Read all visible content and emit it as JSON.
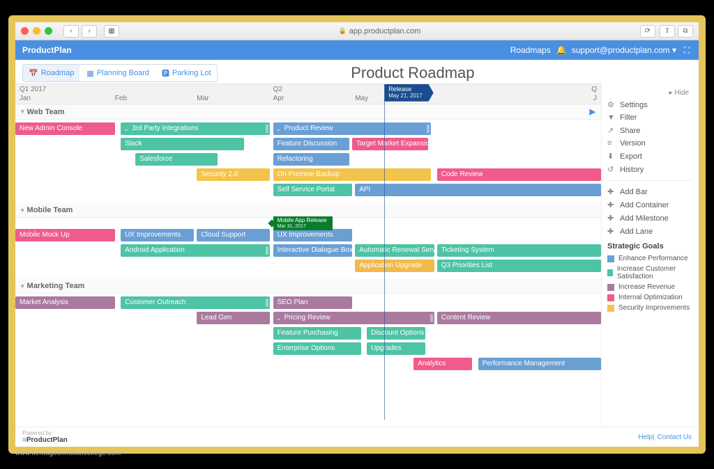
{
  "browser": {
    "url": "app.productplan.com"
  },
  "header": {
    "brand": "ProductPlan",
    "roadmaps": "Roadmaps",
    "user": "support@productplan.com ▾"
  },
  "viewtabs": {
    "roadmap": "Roadmap",
    "planning": "Planning Board",
    "parking": "Parking Lot"
  },
  "title": "Product Roadmap",
  "timeline": {
    "q1": "Q1 2017",
    "q2": "Q2",
    "jan": "Jan",
    "feb": "Feb",
    "mar": "Mar",
    "apr": "Apr",
    "may": "May",
    "jun": "J"
  },
  "release": {
    "title": "Release",
    "date": "May 21, 2017"
  },
  "lanes": {
    "web": "Web Team",
    "mobile": "Mobile Team",
    "marketing": "Marketing Team"
  },
  "mobile_ms": {
    "title": "Mobile App Release",
    "date": "Mar 31, 2017"
  },
  "bars": {
    "new_admin": "New Admin Console",
    "third_party": "3rd Party Integrations",
    "slack": "Slack",
    "salesforce": "Salesforce",
    "security20": "Security 2.0",
    "product_review": "Product Review",
    "feature_disc": "Feature Discussion",
    "target_market": "Target Market Expansion",
    "refactoring": "Refactoring",
    "on_premise": "On Premise Backup",
    "self_service": "Self Service Portal",
    "api": "API",
    "code_review": "Code Review",
    "mobile_mock": "Mobile Mock Up",
    "ux_improve": "UX Improvements",
    "cloud_support": "Cloud Support",
    "ux_improve2": "UX Improvements",
    "android": "Android Application",
    "dialogue": "Interactive Dialogue Box",
    "auto_renewal": "Automatic Renewal Service",
    "ticketing": "Ticketing System",
    "app_upgrade": "Application Upgrade",
    "q3_prio": "Q3 Priorities List",
    "market_analysis": "Market Analysis",
    "cust_outreach": "Customer Outreach",
    "seo": "SEO Plan",
    "lead_gen": "Lead Gen",
    "pricing_review": "Pricing Review",
    "feature_purch": "Feature Purchasing",
    "discount": "Discount Options",
    "enterprise": "Enterprise Options",
    "upgrades": "Upgrades",
    "content_review": "Content Review",
    "analytics": "Analytics",
    "perf_mgmt": "Performance Management"
  },
  "side": {
    "hide": "Hide",
    "settings": "Settings",
    "filter": "Filter",
    "share": "Share",
    "version": "Version",
    "export": "Export",
    "history": "History",
    "add_bar": "Add Bar",
    "add_container": "Add Container",
    "add_milestone": "Add Milestone",
    "add_lane": "Add Lane",
    "goals_head": "Strategic Goals",
    "goals": {
      "enhance": "Enhance Performance",
      "customer": "Increase Customer Satisfaction",
      "revenue": "Increase Revenue",
      "internal": "Internal Optimization",
      "security": "Security Improvements"
    }
  },
  "footer": {
    "powered": "Powered by",
    "brand": "ProductPlan",
    "help": "Help",
    "contact": "Contact Us"
  },
  "watermark": "www.heritagechristiancollege.com",
  "colors": {
    "pink": "#ef5b8a",
    "teal": "#4ec3a5",
    "blue": "#6a9fd4",
    "yellow": "#f3c44b",
    "mauve": "#a97a9e"
  }
}
